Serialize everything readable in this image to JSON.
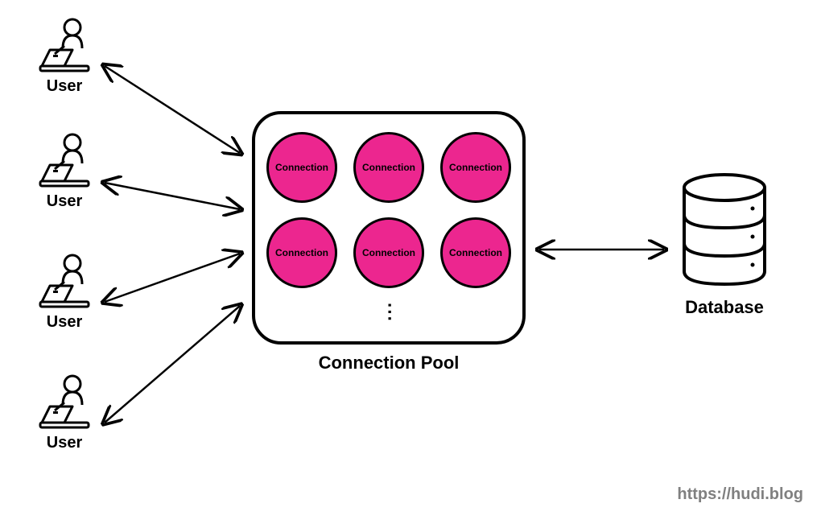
{
  "users": [
    {
      "label": "User"
    },
    {
      "label": "User"
    },
    {
      "label": "User"
    },
    {
      "label": "User"
    }
  ],
  "pool": {
    "label": "Connection Pool",
    "connection_label": "Connection",
    "connections_shown": 6
  },
  "database": {
    "label": "Database"
  },
  "watermark": "https://hudi.blog",
  "colors": {
    "connection_fill": "#ec268f",
    "stroke": "#000000",
    "watermark": "#808080"
  }
}
